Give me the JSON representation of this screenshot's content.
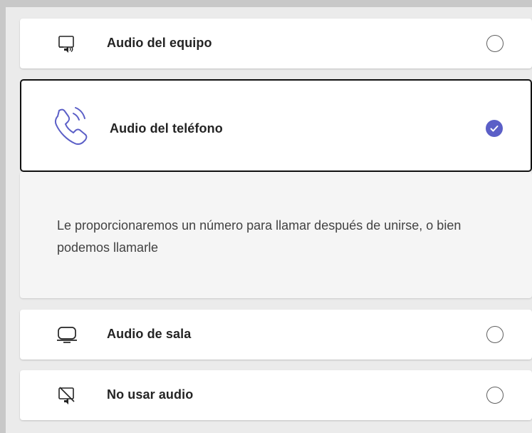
{
  "options": [
    {
      "label": "Audio del equipo",
      "icon": "computer-audio-icon",
      "selected": false
    },
    {
      "label": "Audio del teléfono",
      "icon": "phone-audio-icon",
      "selected": true
    },
    {
      "label": "Audio de sala",
      "icon": "room-audio-icon",
      "selected": false
    },
    {
      "label": "No usar audio",
      "icon": "no-audio-icon",
      "selected": false
    }
  ],
  "phone_audio_description": "Le proporcionaremos un número para llamar después de unirse, o bien podemos llamarle",
  "colors": {
    "accent": "#5b5fc7",
    "selected_border": "#111111"
  }
}
